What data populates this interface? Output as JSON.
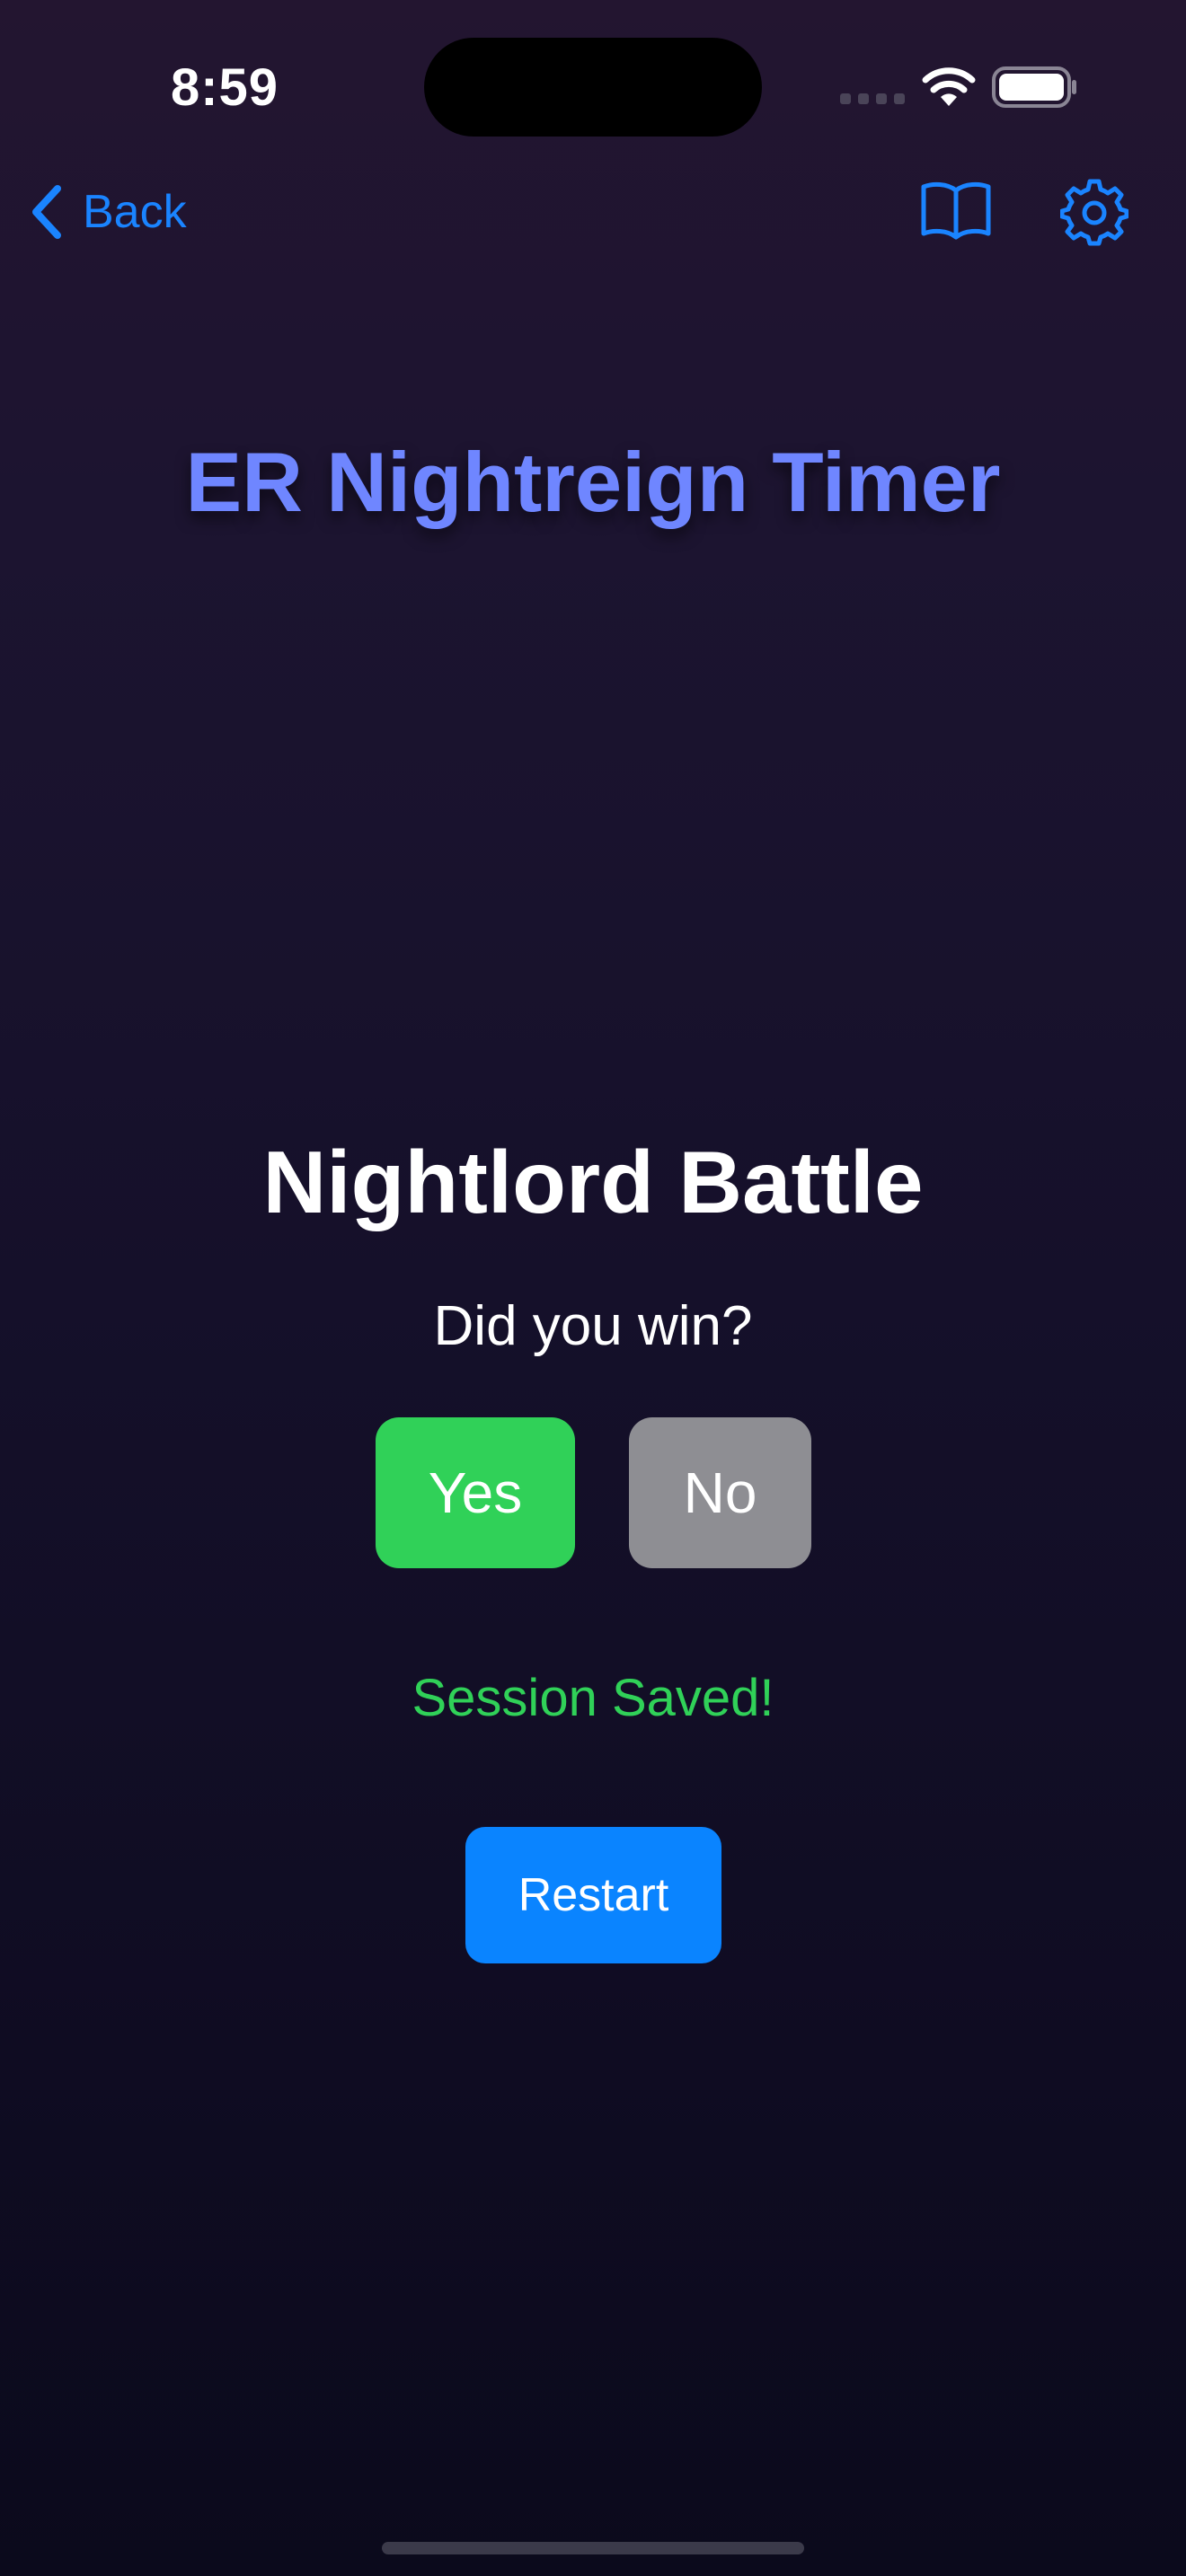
{
  "status_bar": {
    "time": "8:59"
  },
  "nav": {
    "back_label": "Back",
    "icons": [
      "chevron-left-icon",
      "book-icon",
      "gear-icon"
    ],
    "accent_color": "#1a84ff"
  },
  "app": {
    "title": "ER Nightreign Timer",
    "title_color": "#6f86ff"
  },
  "battle": {
    "heading": "Nightlord Battle",
    "question": "Did you win?",
    "yes_label": "Yes",
    "no_label": "No",
    "yes_color": "#30d158",
    "no_color": "#8e8e93",
    "status_message": "Session Saved!",
    "status_color": "#30d158",
    "restart_label": "Restart",
    "restart_color": "#0a84ff"
  }
}
